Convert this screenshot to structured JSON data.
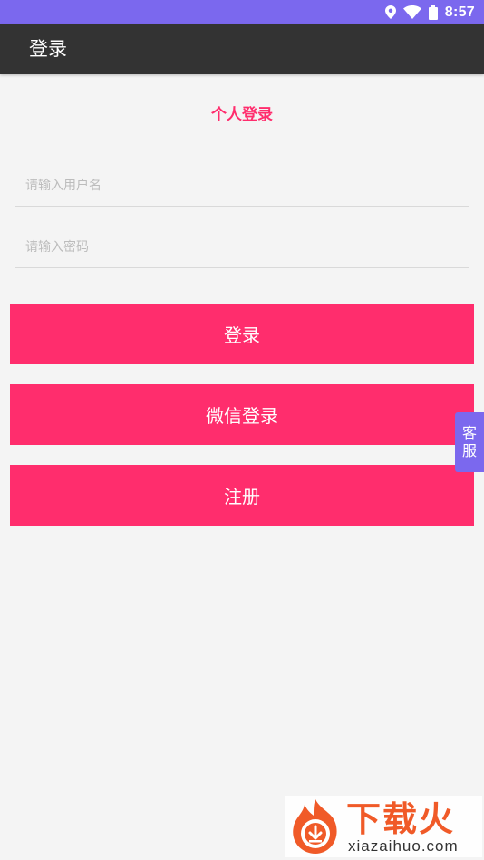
{
  "status_bar": {
    "time": "8:57",
    "icons": [
      "location-icon",
      "wifi-icon",
      "battery-icon"
    ],
    "background_color": "#7b68ee"
  },
  "app_bar": {
    "title": "登录",
    "background_color": "#333333"
  },
  "login_form": {
    "section_title": "个人登录",
    "accent_color": "#ff2d6d",
    "username_placeholder": "请输入用户名",
    "username_value": "",
    "password_placeholder": "请输入密码",
    "password_value": "",
    "login_label": "登录",
    "wechat_login_label": "微信登录",
    "register_label": "注册"
  },
  "customer_service": {
    "line1": "客",
    "line2": "服"
  },
  "watermark": {
    "title": "下载火",
    "url": "xiazaihuo.com"
  }
}
